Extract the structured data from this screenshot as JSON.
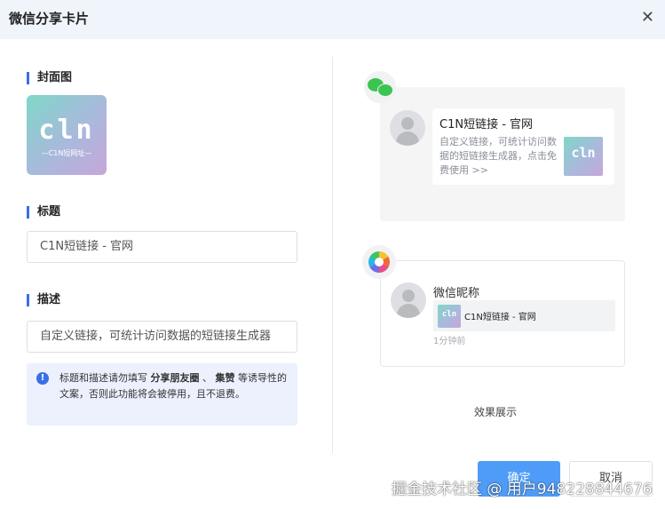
{
  "dialog": {
    "title": "微信分享卡片",
    "close_icon": "close-icon"
  },
  "cover": {
    "label": "封面图",
    "logo_text": "cln",
    "logo_sub": "—C1N短网址—"
  },
  "title_field": {
    "label": "标题",
    "value": "C1N短链接 - 官网"
  },
  "desc_field": {
    "label": "描述",
    "value": "自定义链接，可统计访问数据的短链接生成器"
  },
  "tip": {
    "icon": "info-icon",
    "prefix": "标题和描述请勿填写 ",
    "strong1": "分享朋友圈",
    "sep": " 、 ",
    "strong2": "集赞",
    "suffix": " 等诱导性的文案，否则此功能将会被停用，且不退费。"
  },
  "preview_chat": {
    "icon": "wechat-icon",
    "card_title": "C1N短链接 - 官网",
    "card_desc": "自定义链接，可统计访问数据的短链接生成器，点击免费使用 >>",
    "thumb_text": "cln"
  },
  "preview_moments": {
    "icon": "moments-icon",
    "nickname": "微信昵称",
    "card_title": "C1N短链接 - 官网",
    "time": "1分钟前",
    "thumb_text": "cln"
  },
  "effect_label": "效果展示",
  "buttons": {
    "ok": "确定",
    "cancel": "取消"
  },
  "watermark": "掘金技术社区 @ 用户948228844676",
  "colors": {
    "accent": "#3a6ee8",
    "primary_button": "#4e9cf7",
    "header_bg": "#f0f5fc"
  }
}
